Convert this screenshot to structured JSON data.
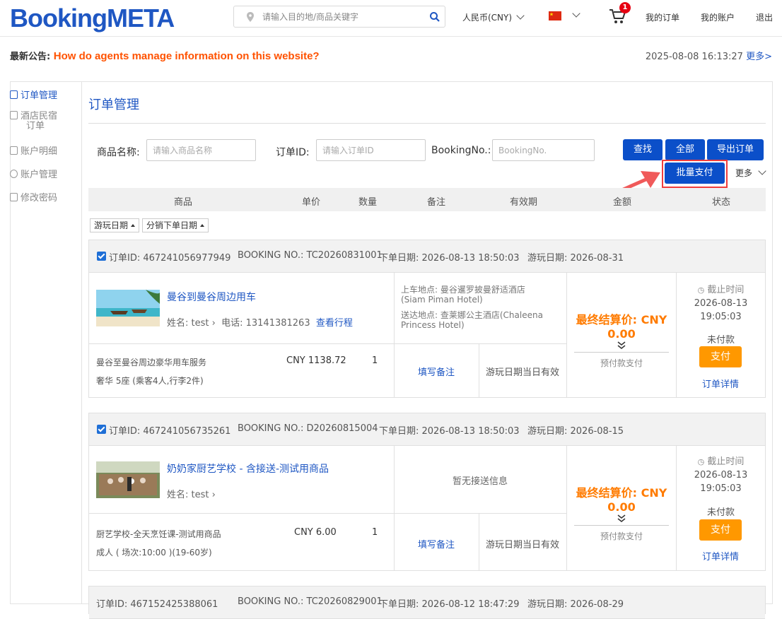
{
  "header": {
    "logo_text": "BookingMETA",
    "search_placeholder": "请输入目的地/商品关键字",
    "currency": "人民币(CNY)",
    "cart_count": "1",
    "my_orders": "我的订单",
    "my_account": "我的账户",
    "logout": "退出"
  },
  "notice": {
    "label": "最新公告: ",
    "text": "How do agents manage information on this website?",
    "datetime": "2025-08-08 16:13:27",
    "more": "更多>"
  },
  "sidebar": {
    "items": [
      {
        "label": "订单管理"
      },
      {
        "label": "酒店民宿",
        "label2": "订单"
      },
      {
        "label": "账户明细"
      },
      {
        "label": "账户管理"
      },
      {
        "label": "修改密码"
      }
    ]
  },
  "page_title": "订单管理",
  "filters": {
    "product_label": "商品名称:",
    "product_placeholder": "请输入商品名称",
    "order_id_label": "订单ID:",
    "order_id_placeholder": "请输入订单ID",
    "booking_label": "BookingNo.:",
    "booking_placeholder": "BookingNo."
  },
  "buttons": {
    "find": "查找",
    "all": "全部",
    "export": "导出订单",
    "batch_pay": "批量支付",
    "more": "更多"
  },
  "table_headers": [
    "商品",
    "单价",
    "数量",
    "备注",
    "有效期",
    "金额",
    "状态"
  ],
  "sort_buttons": [
    "游玩日期",
    "分销下单日期"
  ],
  "orders": [
    {
      "order_id": "订单ID: 467241056977949",
      "booking_no": "BOOKING NO.: TC20260831001",
      "order_date": "下单日期: 2026-08-13 18:50:03",
      "play_date": "游玩日期: 2026-08-31",
      "product_name": "曼谷到曼谷周边用车",
      "guest": "姓名: test",
      "phone": "电话: 13141381263",
      "itinerary_link": "查看行程",
      "pickup": "上车地点: 曼谷暹罗披曼舒适酒店",
      "pickup2": "(Siam Piman Hotel)",
      "dropoff": "送达地点: 查莱娜公主酒店(Chaleena",
      "dropoff2": "Princess Hotel)",
      "service_line1": "曼谷至曼谷周边豪华用车服务",
      "service_line2": "奢华 5座 (乘客4人,行李2件)",
      "unit_price": "CNY 1138.72",
      "qty": "1",
      "fill_note": "填写备注",
      "validity": "游玩日期当日有效",
      "final_label": "最终结算价: CNY",
      "final_amount": "0.00",
      "prepay": "预付款支付",
      "deadline_label": "截止时间",
      "deadline_date": "2026-08-13",
      "deadline_time": "19:05:03",
      "status": "未付款",
      "pay": "支付",
      "detail": "订单详情"
    },
    {
      "order_id": "订单ID: 467241056735261",
      "booking_no": "BOOKING NO.: D20260815004",
      "order_date": "下单日期: 2026-08-13 18:50:03",
      "play_date": "游玩日期: 2026-08-15",
      "product_name": "奶奶家厨艺学校 - 含接送-测试用商品",
      "guest": "姓名: test",
      "transfer": "暂无接送信息",
      "service_line1": "厨艺学校-全天烹饪课-测试用商品",
      "service_line2": "成人 ( 场次:10:00 )(19-60岁)",
      "unit_price": "CNY 6.00",
      "qty": "1",
      "fill_note": "填写备注",
      "validity": "游玩日期当日有效",
      "final_label": "最终结算价: CNY",
      "final_amount": "0.00",
      "prepay": "预付款支付",
      "deadline_label": "截止时间",
      "deadline_date": "2026-08-13",
      "deadline_time": "19:05:03",
      "status": "未付款",
      "pay": "支付",
      "detail": "订单详情"
    },
    {
      "order_id": "订单ID: 467152425388061",
      "booking_no": "BOOKING NO.: TC20260829001",
      "order_date": "下单日期: 2026-08-12 18:47:29",
      "play_date": "游玩日期: 2026-08-29"
    }
  ]
}
